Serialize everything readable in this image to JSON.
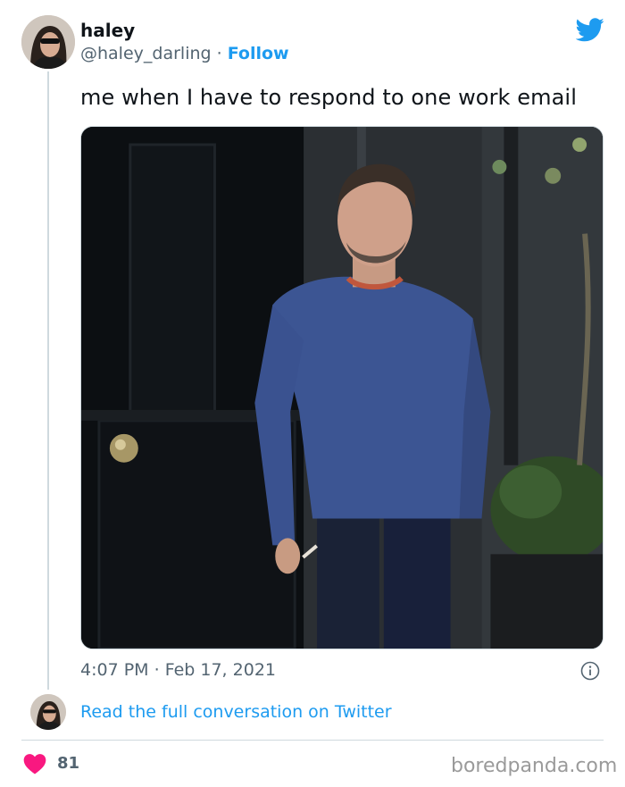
{
  "tweet": {
    "display_name": "haley",
    "handle": "@haley_darling",
    "separator": "·",
    "follow_label": "Follow",
    "text": "me when I have to respond to one work email",
    "time": "4:07 PM",
    "date": "Feb 17, 2021",
    "read_full_label": "Read the full conversation on Twitter",
    "like_count": "81"
  },
  "icons": {
    "brand": "twitter-bird-icon",
    "info": "info-icon",
    "like": "heart-icon"
  },
  "footer": {
    "watermark": "boredpanda.com"
  },
  "colors": {
    "accent": "#1d9bf0",
    "heart": "#f91880",
    "secondary_text": "#536471"
  }
}
